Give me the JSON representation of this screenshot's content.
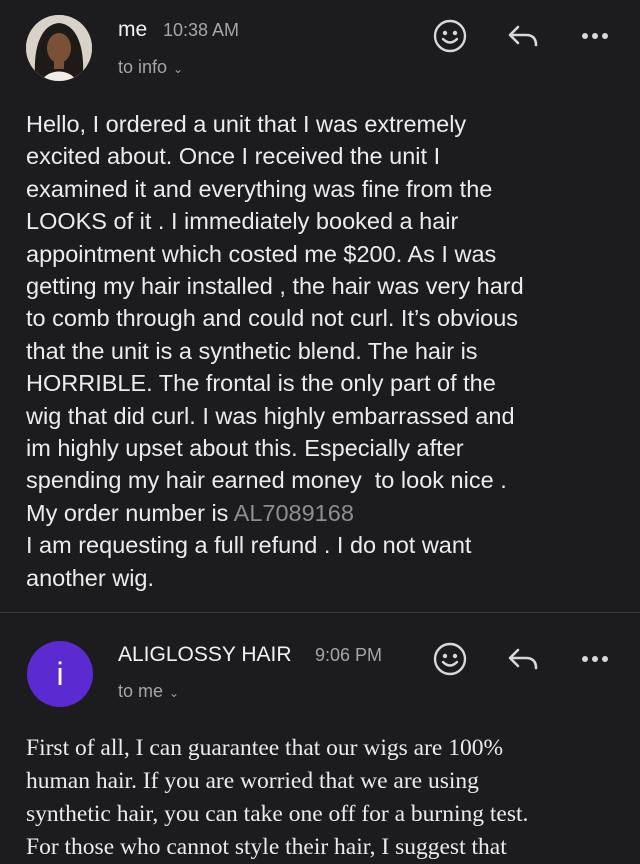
{
  "email1": {
    "sender": "me",
    "time": "10:38 AM",
    "recipient": "to info",
    "body_lines": [
      "Hello, I ordered a unit that I was extremely",
      "excited about. Once I received the unit I",
      "examined it and everything was fine from the",
      "LOOKS of it . I immediately booked a hair",
      "appointment which costed me $200. As I was",
      "getting my hair installed , the hair was very hard",
      "to comb through and could not curl. It’s obvious",
      "that the unit is a synthetic blend. The hair is",
      "HORRIBLE. The frontal is the only part of the",
      "wig that did curl. I was highly embarrassed and",
      "im highly upset about this. Especially after",
      "spending my hair earned money  to look nice ."
    ],
    "order_prefix": "My order number is ",
    "order_number": "AL7089168",
    "body_lines_after": [
      "I am requesting a full refund . I do not want",
      "another wig."
    ]
  },
  "email2": {
    "avatar_letter": "i",
    "sender": "ALIGLOSSY HAIR",
    "time": "9:06 PM",
    "recipient": "to me",
    "body_lines": [
      "First of all, I can guarantee that our wigs are 100%",
      "human hair. If you are worried that we are using",
      "synthetic hair, you can take one off for a burning test.",
      "For those who cannot style their hair, I suggest that"
    ]
  },
  "colors": {
    "background": "#1c1c1e",
    "avatar_purple": "#5b2ad1",
    "link_gray": "#8e8e93"
  }
}
